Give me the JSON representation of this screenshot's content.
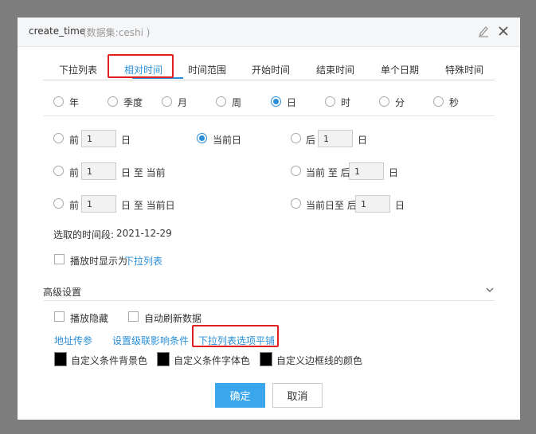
{
  "dialog": {
    "title": "create_time",
    "subtitle": "(数据集:ceshi )",
    "icons": {
      "edit": "edit-icon",
      "close": "close-icon"
    }
  },
  "tabs": [
    "下拉列表",
    "相对时间",
    "时间范围",
    "开始时间",
    "结束时间",
    "单个日期",
    "特殊时间"
  ],
  "active_tab": "相对时间",
  "granularity": {
    "options": [
      "年",
      "季度",
      "月",
      "周",
      "日",
      "时",
      "分",
      "秒"
    ],
    "selected": "日"
  },
  "relative": {
    "row1": {
      "before_label": "前",
      "before_value": "1",
      "before_unit": "日",
      "current_label": "当前日",
      "after_label": "后",
      "after_value": "1",
      "after_unit": "日"
    },
    "row2": {
      "before_label": "前",
      "before_value": "1",
      "before_unit": "日 至 当前",
      "after_label": "当前 至 后",
      "after_value": "1",
      "after_unit": "日"
    },
    "row3": {
      "before_label": "前",
      "before_value": "1",
      "before_unit": "日 至 当前日",
      "after_label": "当前日至 后",
      "after_value": "1",
      "after_unit": "日"
    },
    "selected": "当前日"
  },
  "selected_period": {
    "label": "选取的时间段:",
    "value": "2021-12-29"
  },
  "play_display": {
    "label": "播放时显示为",
    "link": "下拉列表",
    "checked": false
  },
  "advanced": {
    "title": "高级设置",
    "checkboxes": [
      {
        "label": "播放隐藏",
        "checked": false
      },
      {
        "label": "自动刷新数据",
        "checked": false
      }
    ],
    "links": [
      "地址传参",
      "设置级联影响条件",
      "下拉列表选项平铺"
    ],
    "colors": [
      {
        "label": "自定义条件背景色",
        "color": "#000000"
      },
      {
        "label": "自定义条件字体色",
        "color": "#000000"
      },
      {
        "label": "自定义边框线的颜色",
        "color": "#000000"
      }
    ]
  },
  "buttons": {
    "ok": "确定",
    "cancel": "取消"
  },
  "colors": {
    "accent": "#2a8fd8",
    "primary_button": "#3aa6ec",
    "highlight": "#e02020"
  }
}
